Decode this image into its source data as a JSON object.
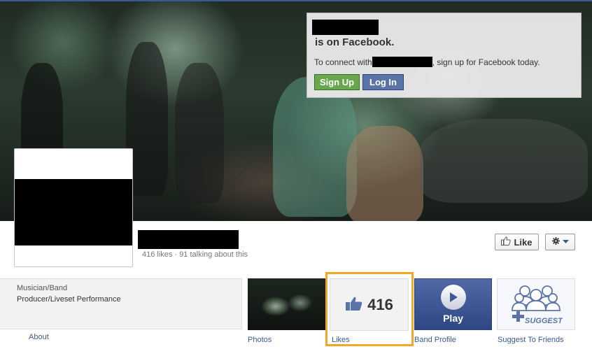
{
  "connect": {
    "title": "is on Facebook.",
    "msg_prefix": "To connect with",
    "msg_suffix": ", sign up for Facebook today.",
    "signup_label": "Sign Up",
    "login_label": "Log In"
  },
  "page": {
    "stats": "416 likes · 91 talking about this",
    "like_label": "Like"
  },
  "about": {
    "category": "Musician/Band",
    "description": "Producer/Liveset Performance",
    "link": "About"
  },
  "apps": {
    "photos_label": "Photos",
    "likes_count": "416",
    "likes_label": "Likes",
    "play_text": "Play",
    "band_profile_label": "Band Profile",
    "suggest_label": "Suggest To Friends"
  },
  "colors": {
    "facebook_blue": "#3b5998",
    "signup_green": "#69a74e",
    "highlight_orange": "#f5a623"
  },
  "icons": [
    "thumbs-up-icon",
    "gear-icon",
    "chevron-down-icon",
    "play-icon",
    "suggest-friends-icon"
  ]
}
